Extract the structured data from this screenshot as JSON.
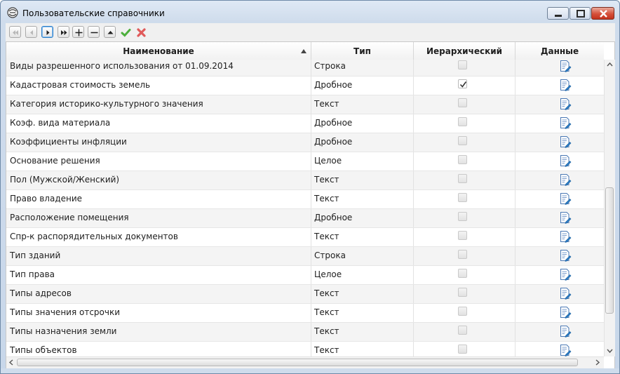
{
  "window": {
    "title": "Пользовательские справочники"
  },
  "table": {
    "columns": [
      "Наименование",
      "Тип",
      "Иерархический",
      "Данные"
    ],
    "rows": [
      {
        "name": "Виды разрешенного использования от 01.09.2014",
        "type": "Строка",
        "hierarchical": false
      },
      {
        "name": "Кадастровая стоимость земель",
        "type": "Дробное",
        "hierarchical": true
      },
      {
        "name": "Категория историко-культурного значения",
        "type": "Текст",
        "hierarchical": false
      },
      {
        "name": "Коэф. вида материала",
        "type": "Дробное",
        "hierarchical": false
      },
      {
        "name": "Коэффициенты инфляции",
        "type": "Дробное",
        "hierarchical": false
      },
      {
        "name": "Основание решения",
        "type": "Целое",
        "hierarchical": false
      },
      {
        "name": "Пол (Мужской/Женский)",
        "type": "Текст",
        "hierarchical": false
      },
      {
        "name": "Право владение",
        "type": "Текст",
        "hierarchical": false
      },
      {
        "name": "Расположение помещения",
        "type": "Дробное",
        "hierarchical": false
      },
      {
        "name": "Спр-к распорядительных документов",
        "type": "Текст",
        "hierarchical": false
      },
      {
        "name": "Тип зданий",
        "type": "Строка",
        "hierarchical": false
      },
      {
        "name": "Тип права",
        "type": "Целое",
        "hierarchical": false
      },
      {
        "name": "Типы адресов",
        "type": "Текст",
        "hierarchical": false
      },
      {
        "name": "Типы значения отсрочки",
        "type": "Текст",
        "hierarchical": false
      },
      {
        "name": "Типы назначения земли",
        "type": "Текст",
        "hierarchical": false
      },
      {
        "name": "Типы объектов",
        "type": "Текст",
        "hierarchical": false
      }
    ]
  },
  "icons": {
    "toolbar": [
      "first-record-icon",
      "prev-record-icon",
      "next-record-icon",
      "last-record-icon",
      "add-icon",
      "remove-icon",
      "move-up-icon",
      "confirm-icon",
      "cancel-icon"
    ],
    "data_cell": "edit-document-icon"
  },
  "colors": {
    "accent": "#2c7ec8",
    "close_button": "#c3331d",
    "confirm": "#4caf3c",
    "cancel": "#e05a5a"
  }
}
